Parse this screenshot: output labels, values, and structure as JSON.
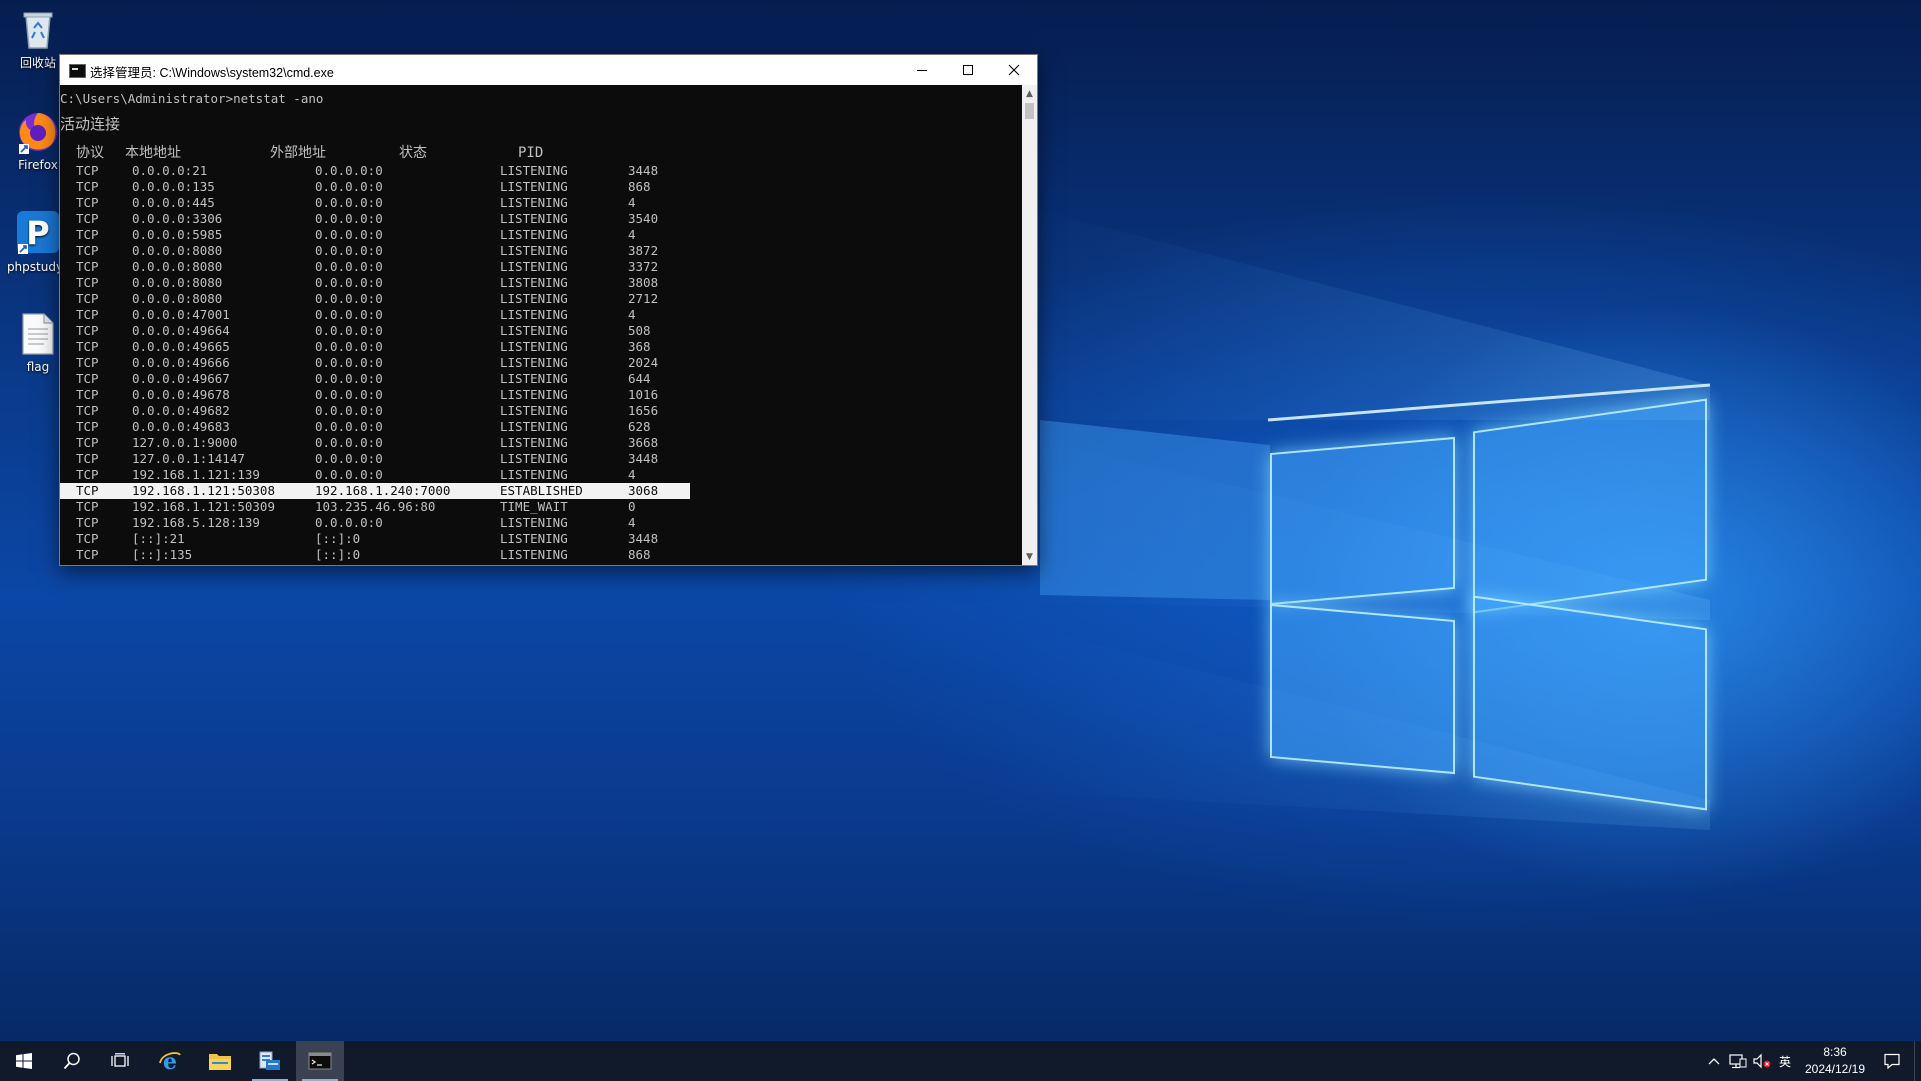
{
  "desktop": {
    "icons": [
      {
        "label": "回收站"
      },
      {
        "label": "Firefox"
      },
      {
        "label": "phpstudy_"
      },
      {
        "label": "flag"
      }
    ]
  },
  "cmd": {
    "title": "选择管理员: C:\\Windows\\system32\\cmd.exe",
    "prompt_line": "C:\\Users\\Administrator>netstat -ano",
    "section_heading": "活动连接",
    "columns": [
      "协议",
      "本地地址",
      "外部地址",
      "状态",
      "PID"
    ],
    "rows": [
      [
        "TCP",
        "0.0.0.0:21",
        "0.0.0.0:0",
        "LISTENING",
        "3448"
      ],
      [
        "TCP",
        "0.0.0.0:135",
        "0.0.0.0:0",
        "LISTENING",
        "868"
      ],
      [
        "TCP",
        "0.0.0.0:445",
        "0.0.0.0:0",
        "LISTENING",
        "4"
      ],
      [
        "TCP",
        "0.0.0.0:3306",
        "0.0.0.0:0",
        "LISTENING",
        "3540"
      ],
      [
        "TCP",
        "0.0.0.0:5985",
        "0.0.0.0:0",
        "LISTENING",
        "4"
      ],
      [
        "TCP",
        "0.0.0.0:8080",
        "0.0.0.0:0",
        "LISTENING",
        "3872"
      ],
      [
        "TCP",
        "0.0.0.0:8080",
        "0.0.0.0:0",
        "LISTENING",
        "3372"
      ],
      [
        "TCP",
        "0.0.0.0:8080",
        "0.0.0.0:0",
        "LISTENING",
        "3808"
      ],
      [
        "TCP",
        "0.0.0.0:8080",
        "0.0.0.0:0",
        "LISTENING",
        "2712"
      ],
      [
        "TCP",
        "0.0.0.0:47001",
        "0.0.0.0:0",
        "LISTENING",
        "4"
      ],
      [
        "TCP",
        "0.0.0.0:49664",
        "0.0.0.0:0",
        "LISTENING",
        "508"
      ],
      [
        "TCP",
        "0.0.0.0:49665",
        "0.0.0.0:0",
        "LISTENING",
        "368"
      ],
      [
        "TCP",
        "0.0.0.0:49666",
        "0.0.0.0:0",
        "LISTENING",
        "2024"
      ],
      [
        "TCP",
        "0.0.0.0:49667",
        "0.0.0.0:0",
        "LISTENING",
        "644"
      ],
      [
        "TCP",
        "0.0.0.0:49678",
        "0.0.0.0:0",
        "LISTENING",
        "1016"
      ],
      [
        "TCP",
        "0.0.0.0:49682",
        "0.0.0.0:0",
        "LISTENING",
        "1656"
      ],
      [
        "TCP",
        "0.0.0.0:49683",
        "0.0.0.0:0",
        "LISTENING",
        "628"
      ],
      [
        "TCP",
        "127.0.0.1:9000",
        "0.0.0.0:0",
        "LISTENING",
        "3668"
      ],
      [
        "TCP",
        "127.0.0.1:14147",
        "0.0.0.0:0",
        "LISTENING",
        "3448"
      ],
      [
        "TCP",
        "192.168.1.121:139",
        "0.0.0.0:0",
        "LISTENING",
        "4"
      ],
      [
        "TCP",
        "192.168.1.121:50308",
        "192.168.1.240:7000",
        "ESTABLISHED",
        "3068"
      ],
      [
        "TCP",
        "192.168.1.121:50309",
        "103.235.46.96:80",
        "TIME_WAIT",
        "0"
      ],
      [
        "TCP",
        "192.168.5.128:139",
        "0.0.0.0:0",
        "LISTENING",
        "4"
      ],
      [
        "TCP",
        "[::]:21",
        "[::]:0",
        "LISTENING",
        "3448"
      ],
      [
        "TCP",
        "[::]:135",
        "[::]:0",
        "LISTENING",
        "868"
      ]
    ],
    "selected_row": 20
  },
  "taskbar": {
    "input_indicator": "英",
    "time": "8:36",
    "date": "2024/12/19"
  }
}
